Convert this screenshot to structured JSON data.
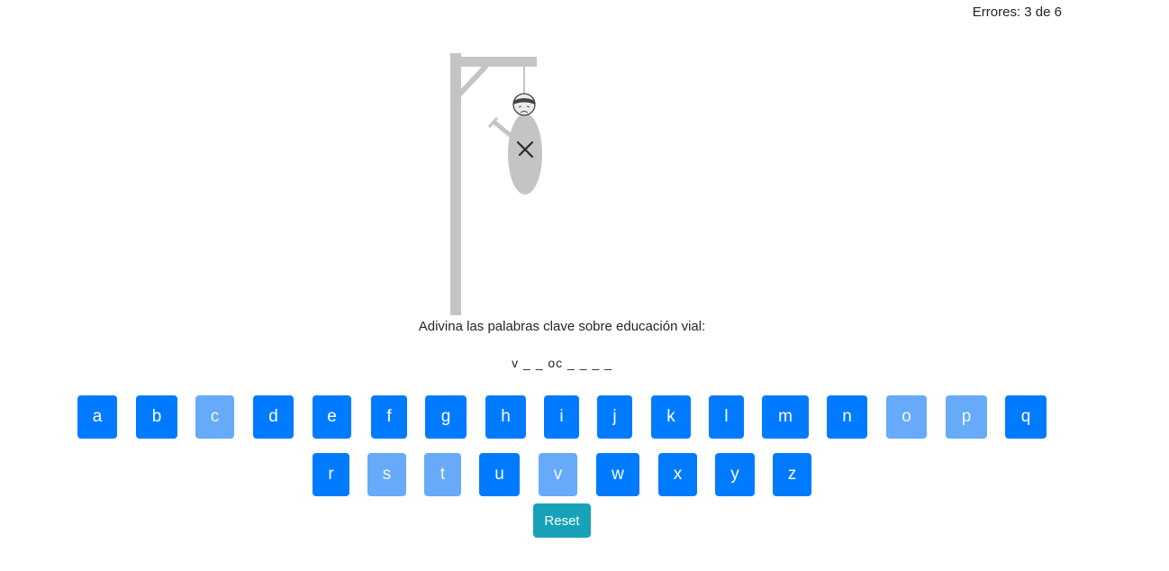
{
  "status": {
    "errors_text": "Errores: 3 de 6",
    "errors": 3,
    "max_errors": 6
  },
  "game": {
    "prompt": "Adivina las palabras clave sobre educación vial:",
    "masked_word": "v _ _ oc _ _ _ _"
  },
  "keyboard": {
    "row1": [
      {
        "letter": "a",
        "used": false
      },
      {
        "letter": "b",
        "used": false
      },
      {
        "letter": "c",
        "used": true
      },
      {
        "letter": "d",
        "used": false
      },
      {
        "letter": "e",
        "used": false
      },
      {
        "letter": "f",
        "used": false
      },
      {
        "letter": "g",
        "used": false
      },
      {
        "letter": "h",
        "used": false
      },
      {
        "letter": "i",
        "used": false
      },
      {
        "letter": "j",
        "used": false
      },
      {
        "letter": "k",
        "used": false
      },
      {
        "letter": "l",
        "used": false
      },
      {
        "letter": "m",
        "used": false
      },
      {
        "letter": "n",
        "used": false
      },
      {
        "letter": "o",
        "used": true
      },
      {
        "letter": "p",
        "used": true
      },
      {
        "letter": "q",
        "used": false
      }
    ],
    "row2": [
      {
        "letter": "r",
        "used": false
      },
      {
        "letter": "s",
        "used": true
      },
      {
        "letter": "t",
        "used": true
      },
      {
        "letter": "u",
        "used": false
      },
      {
        "letter": "v",
        "used": true
      },
      {
        "letter": "w",
        "used": false
      },
      {
        "letter": "x",
        "used": false
      },
      {
        "letter": "y",
        "used": false
      },
      {
        "letter": "z",
        "used": false
      }
    ],
    "reset_label": "Reset"
  },
  "colors": {
    "key": "#007bff",
    "key_used": "#66aaf9",
    "reset": "#17a2b8",
    "gallows": "#c4c4c4"
  }
}
